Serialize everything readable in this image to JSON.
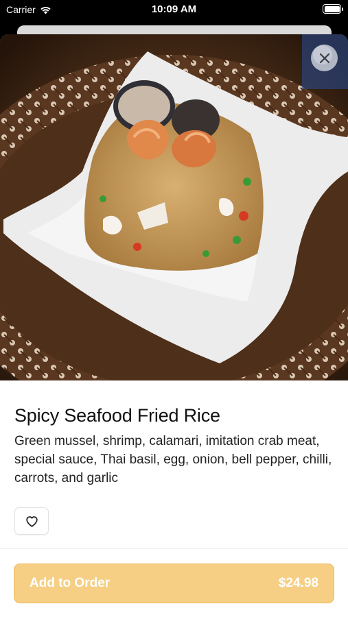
{
  "status_bar": {
    "carrier": "Carrier",
    "time": "10:09 AM",
    "wifi_icon": "wifi-icon",
    "battery_icon": "battery-icon"
  },
  "item": {
    "image_alt": "Plate of spicy seafood fried rice with shrimp and mussels",
    "title": "Spicy Seafood Fried Rice",
    "description": "Green mussel, shrimp, calamari, imitation crab meat, special sauce, Thai basil, egg, onion, bell pepper, chilli, carrots, and garlic"
  },
  "actions": {
    "close_icon": "close-icon",
    "favorite_icon": "heart-icon",
    "add_to_order_label": "Add to Order",
    "price": "$24.98"
  },
  "colors": {
    "add_button_bg": "#f6cf84",
    "add_button_border": "#eeb95a",
    "close_button_bg": "#c8cdd7"
  }
}
